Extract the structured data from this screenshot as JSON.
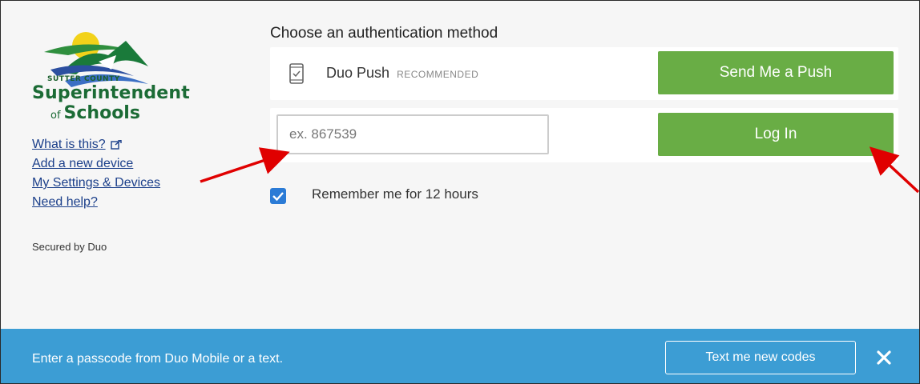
{
  "logo": {
    "line1": "SUTTER COUNTY",
    "line2": "Superintendent",
    "of": "of",
    "line3": "Schools"
  },
  "sidebar": {
    "links": [
      {
        "label": "What is this?",
        "icon": "external-link-icon"
      },
      {
        "label": "Add a new device"
      },
      {
        "label": "My Settings & Devices"
      },
      {
        "label": "Need help?"
      }
    ],
    "secured": "Secured by Duo"
  },
  "main": {
    "heading": "Choose an authentication method",
    "push": {
      "icon": "phone-icon",
      "label": "Duo Push",
      "recommended": "RECOMMENDED",
      "button": "Send Me a Push"
    },
    "passcode": {
      "placeholder": "ex. 867539",
      "value": "",
      "button": "Log In"
    },
    "remember": {
      "checked": true,
      "label": "Remember me for 12 hours"
    }
  },
  "status_bar": {
    "message": "Enter a passcode from Duo Mobile or a text.",
    "button": "Text me new codes",
    "close_icon": "close-icon"
  },
  "colors": {
    "accent_green": "#69ad45",
    "bar_blue": "#3c9dd4",
    "checkbox_blue": "#2b7bd6",
    "link_blue": "#1b3f8a",
    "annotation_red": "#e00000"
  }
}
